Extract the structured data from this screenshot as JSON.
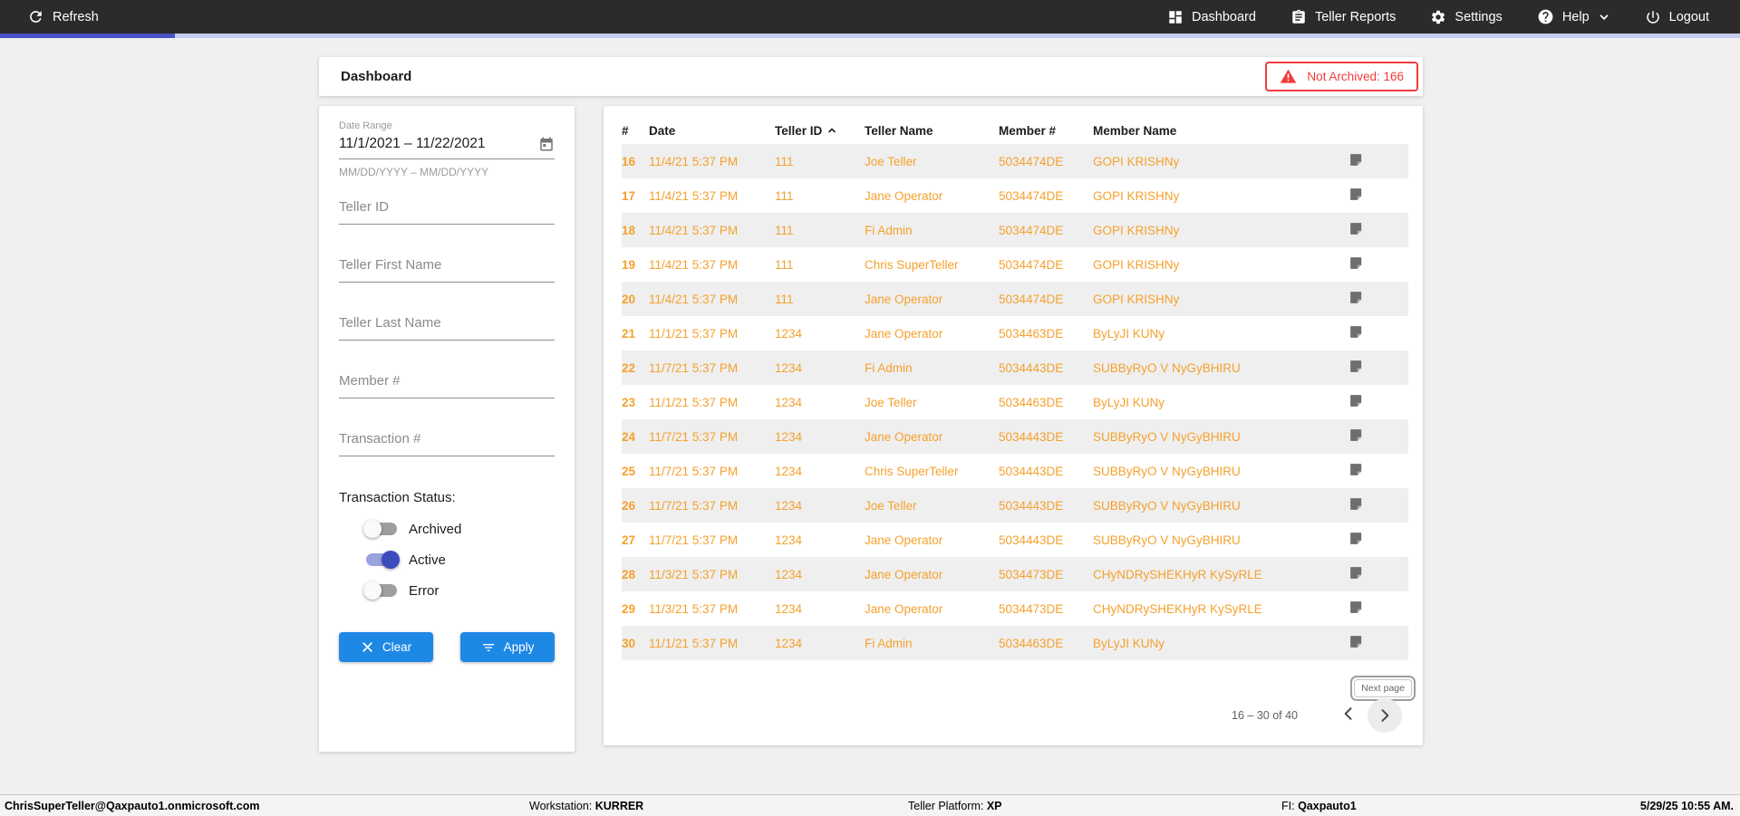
{
  "nav": {
    "refresh_label": "Refresh",
    "items": [
      {
        "label": "Dashboard",
        "icon": "dashboard-grid-icon"
      },
      {
        "label": "Teller Reports",
        "icon": "clipboard-icon"
      },
      {
        "label": "Settings",
        "icon": "gear-icon"
      },
      {
        "label": "Help",
        "icon": "help-icon"
      },
      {
        "label": "Logout",
        "icon": "power-icon"
      }
    ]
  },
  "header": {
    "title": "Dashboard",
    "alert": "Not Archived: 166",
    "alert_icon": "warning-triangle-icon"
  },
  "filters": {
    "date_range": {
      "label": "Date Range",
      "value": "11/1/2021 – 11/22/2021",
      "hint": "MM/DD/YYYY – MM/DD/YYYY",
      "icon": "calendar-icon"
    },
    "fields": [
      {
        "placeholder": "Teller ID"
      },
      {
        "placeholder": "Teller First Name"
      },
      {
        "placeholder": "Teller Last Name"
      },
      {
        "placeholder": "Member #"
      },
      {
        "placeholder": "Transaction #"
      }
    ],
    "status_label": "Transaction Status:",
    "toggles": [
      {
        "label": "Archived",
        "on": false
      },
      {
        "label": "Active",
        "on": true
      },
      {
        "label": "Error",
        "on": false
      }
    ],
    "clear_label": "Clear",
    "apply_label": "Apply"
  },
  "table": {
    "columns": [
      "#",
      "Date",
      "Teller ID",
      "Teller Name",
      "Member #",
      "Member Name"
    ],
    "sort": {
      "column": "Teller ID",
      "direction": "asc"
    },
    "rows": [
      {
        "num": "16",
        "date": "11/4/21 5:37 PM",
        "teller_id": "111",
        "teller_name": "Joe Teller",
        "member_num": "5034474DE",
        "member_name": "GOPI KRISHNy"
      },
      {
        "num": "17",
        "date": "11/4/21 5:37 PM",
        "teller_id": "111",
        "teller_name": "Jane Operator",
        "member_num": "5034474DE",
        "member_name": "GOPI KRISHNy"
      },
      {
        "num": "18",
        "date": "11/4/21 5:37 PM",
        "teller_id": "111",
        "teller_name": "Fi Admin",
        "member_num": "5034474DE",
        "member_name": "GOPI KRISHNy"
      },
      {
        "num": "19",
        "date": "11/4/21 5:37 PM",
        "teller_id": "111",
        "teller_name": "Chris SuperTeller",
        "member_num": "5034474DE",
        "member_name": "GOPI KRISHNy"
      },
      {
        "num": "20",
        "date": "11/4/21 5:37 PM",
        "teller_id": "111",
        "teller_name": "Jane Operator",
        "member_num": "5034474DE",
        "member_name": "GOPI KRISHNy"
      },
      {
        "num": "21",
        "date": "11/1/21 5:37 PM",
        "teller_id": "1234",
        "teller_name": "Jane Operator",
        "member_num": "5034463DE",
        "member_name": "ByLyJI KUNy"
      },
      {
        "num": "22",
        "date": "11/7/21 5:37 PM",
        "teller_id": "1234",
        "teller_name": "Fi Admin",
        "member_num": "5034443DE",
        "member_name": "SUBByRyO V NyGyBHIRU"
      },
      {
        "num": "23",
        "date": "11/1/21 5:37 PM",
        "teller_id": "1234",
        "teller_name": "Joe Teller",
        "member_num": "5034463DE",
        "member_name": "ByLyJI KUNy"
      },
      {
        "num": "24",
        "date": "11/7/21 5:37 PM",
        "teller_id": "1234",
        "teller_name": "Jane Operator",
        "member_num": "5034443DE",
        "member_name": "SUBByRyO V NyGyBHIRU"
      },
      {
        "num": "25",
        "date": "11/7/21 5:37 PM",
        "teller_id": "1234",
        "teller_name": "Chris SuperTeller",
        "member_num": "5034443DE",
        "member_name": "SUBByRyO V NyGyBHIRU"
      },
      {
        "num": "26",
        "date": "11/7/21 5:37 PM",
        "teller_id": "1234",
        "teller_name": "Joe Teller",
        "member_num": "5034443DE",
        "member_name": "SUBByRyO V NyGyBHIRU"
      },
      {
        "num": "27",
        "date": "11/7/21 5:37 PM",
        "teller_id": "1234",
        "teller_name": "Jane Operator",
        "member_num": "5034443DE",
        "member_name": "SUBByRyO V NyGyBHIRU"
      },
      {
        "num": "28",
        "date": "11/3/21 5:37 PM",
        "teller_id": "1234",
        "teller_name": "Jane Operator",
        "member_num": "5034473DE",
        "member_name": "CHyNDRySHEKHyR KySyRLE"
      },
      {
        "num": "29",
        "date": "11/3/21 5:37 PM",
        "teller_id": "1234",
        "teller_name": "Jane Operator",
        "member_num": "5034473DE",
        "member_name": "CHyNDRySHEKHyR KySyRLE"
      },
      {
        "num": "30",
        "date": "11/1/21 5:37 PM",
        "teller_id": "1234",
        "teller_name": "Fi Admin",
        "member_num": "5034463DE",
        "member_name": "ByLyJI KUNy"
      }
    ],
    "row_icon": "note-icon"
  },
  "pagination": {
    "tooltip": "Next page",
    "range": "16 – 30 of 40"
  },
  "footer": {
    "user": "ChrisSuperTeller@Qaxpauto1.onmicrosoft.com",
    "workstation_label": "Workstation:",
    "workstation_value": "KURRER",
    "platform_label": "Teller Platform:",
    "platform_value": "XP",
    "fi_label": "FI:",
    "fi_value": "Qaxpauto1",
    "datetime": "5/29/25 10:55 AM."
  },
  "colors": {
    "navbar_bg": "#2b2b2b",
    "progress_primary": "#4753c5",
    "progress_track": "#c6cbf0",
    "alert_red": "#f23b3b",
    "row_orange": "#f5a12d",
    "button_blue": "#1e88e5",
    "toggle_on_thumb": "#3c4cbd",
    "toggle_on_track": "#9aa3de",
    "row_alt_bg": "#efefef"
  }
}
